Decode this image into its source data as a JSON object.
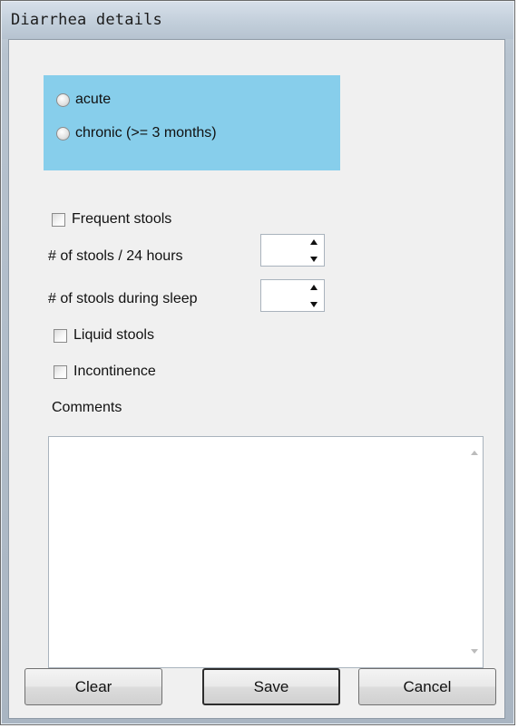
{
  "window": {
    "title": "Diarrhea details"
  },
  "onset": {
    "options": [
      {
        "label": "acute",
        "selected": false
      },
      {
        "label": "chronic (>= 3 months)",
        "selected": false
      }
    ],
    "group_color": "#87ceeb"
  },
  "frequent_stools": {
    "label": "Frequent stools",
    "checked": false
  },
  "stools_per_24h": {
    "label": "# of stools / 24 hours",
    "value": ""
  },
  "stools_during_sleep": {
    "label": "# of stools during sleep",
    "value": ""
  },
  "liquid_stools": {
    "label": "Liquid stools",
    "checked": false
  },
  "incontinence": {
    "label": "Incontinence",
    "checked": false
  },
  "comments": {
    "label": "Comments",
    "value": ""
  },
  "buttons": {
    "clear": "Clear",
    "save": "Save",
    "cancel": "Cancel"
  },
  "icons": [
    "radio-icon",
    "checkbox-icon",
    "spin-up-icon",
    "spin-down-icon",
    "scroll-up-icon",
    "scroll-down-icon"
  ]
}
